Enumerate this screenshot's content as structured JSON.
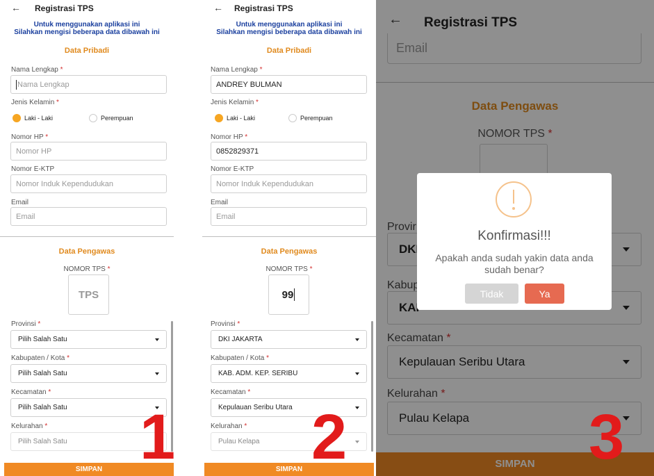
{
  "app": {
    "title": "Registrasi TPS",
    "back_icon": "←",
    "intro_line1": "Untuk menggunakan aplikasi ini",
    "intro_line2": "Silahkan mengisi beberapa data dibawah ini",
    "section_pribadi": "Data Pribadi",
    "section_pengawas": "Data Pengawas",
    "required_mark": "*",
    "save_label": "SIMPAN",
    "colors": {
      "accent": "#f08a24",
      "section": "#e08a1e",
      "intro": "#1a3f9e",
      "step_number": "#e21b1b"
    }
  },
  "form": {
    "nama_label": "Nama Lengkap",
    "nama_placeholder": "Nama Lengkap",
    "jk_label": "Jenis Kelamin",
    "jk_options": [
      "Laki - Laki",
      "Perempuan"
    ],
    "hp_label": "Nomor HP",
    "hp_placeholder": "Nomor HP",
    "ektp_label": "Nomor E-KTP",
    "ektp_placeholder": "Nomor Induk Kependudukan",
    "email_label": "Email",
    "email_placeholder": "Email",
    "tps_label": "NOMOR TPS",
    "tps_placeholder": "TPS",
    "provinsi_label": "Provinsi",
    "kabupaten_label": "Kabupaten / Kota",
    "kecamatan_label": "Kecamatan",
    "kelurahan_label": "Kelurahan",
    "select_placeholder": "Pilih Salah Satu"
  },
  "panel1": {
    "step": "1",
    "selected_gender": "Laki - Laki",
    "provinsi": "Pilih Salah Satu",
    "kabupaten": "Pilih Salah Satu",
    "kecamatan": "Pilih Salah Satu",
    "kelurahan": "Pilih Salah Satu"
  },
  "panel2": {
    "step": "2",
    "nama_value": "ANDREY BULMAN",
    "hp_value": "0852829371",
    "tps_value": "99",
    "provinsi": "DKI JAKARTA",
    "kabupaten": "KAB. ADM. KEP. SERIBU",
    "kecamatan": "Kepulauan Seribu Utara",
    "kelurahan": "Pulau Kelapa"
  },
  "panel3": {
    "step": "3",
    "email_placeholder": "Email",
    "provinsi_partial_label": "Provir",
    "provinsi_partial_value": "DKI",
    "kabupaten_partial_label": "Kabup",
    "kabupaten_partial_value": "KAI",
    "kecamatan": "Kepulauan Seribu Utara",
    "kelurahan": "Pulau Kelapa",
    "dialog": {
      "title": "Konfirmasi!!!",
      "message": "Apakah anda sudah yakin data anda sudah benar?",
      "cancel": "Tidak",
      "confirm": "Ya"
    }
  }
}
